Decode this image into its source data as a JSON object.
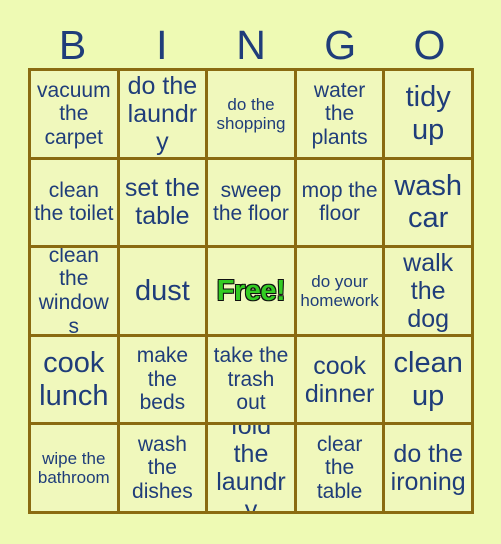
{
  "card": {
    "background_color": "#eefab4",
    "cell_background_color": "#f0f8bc",
    "grid_line_color": "#8a6b11",
    "text_color": "#1f3d7a",
    "free_text_color": "#33cc22",
    "free_outline_color": "#111111"
  },
  "header": {
    "letters": [
      "B",
      "I",
      "N",
      "G",
      "O"
    ]
  },
  "grid": {
    "rows": 5,
    "columns": 5,
    "cells": [
      {
        "text": "vacuum the carpet",
        "size": "md",
        "free": false
      },
      {
        "text": "do the laundry",
        "size": "lg",
        "free": false
      },
      {
        "text": "do the shopping",
        "size": "sm",
        "free": false
      },
      {
        "text": "water the plants",
        "size": "md",
        "free": false
      },
      {
        "text": "tidy up",
        "size": "xl",
        "free": false
      },
      {
        "text": "clean the toilet",
        "size": "md",
        "free": false
      },
      {
        "text": "set the table",
        "size": "lg",
        "free": false
      },
      {
        "text": "sweep the floor",
        "size": "md",
        "free": false
      },
      {
        "text": "mop the floor",
        "size": "md",
        "free": false
      },
      {
        "text": "wash car",
        "size": "xl",
        "free": false
      },
      {
        "text": "clean the windows",
        "size": "md",
        "free": false
      },
      {
        "text": "dust",
        "size": "xl",
        "free": false
      },
      {
        "text": "Free!",
        "size": "xl",
        "free": true
      },
      {
        "text": "do your homework",
        "size": "sm",
        "free": false
      },
      {
        "text": "walk the dog",
        "size": "lg",
        "free": false
      },
      {
        "text": "cook lunch",
        "size": "xl",
        "free": false
      },
      {
        "text": "make the beds",
        "size": "md",
        "free": false
      },
      {
        "text": "take the trash out",
        "size": "md",
        "free": false
      },
      {
        "text": "cook dinner",
        "size": "lg",
        "free": false
      },
      {
        "text": "clean up",
        "size": "xl",
        "free": false
      },
      {
        "text": "wipe the bathroom",
        "size": "sm",
        "free": false
      },
      {
        "text": "wash the dishes",
        "size": "md",
        "free": false
      },
      {
        "text": "fold the laundry",
        "size": "lg",
        "free": false
      },
      {
        "text": "clear the table",
        "size": "md",
        "free": false
      },
      {
        "text": "do the ironing",
        "size": "lg",
        "free": false
      }
    ]
  }
}
